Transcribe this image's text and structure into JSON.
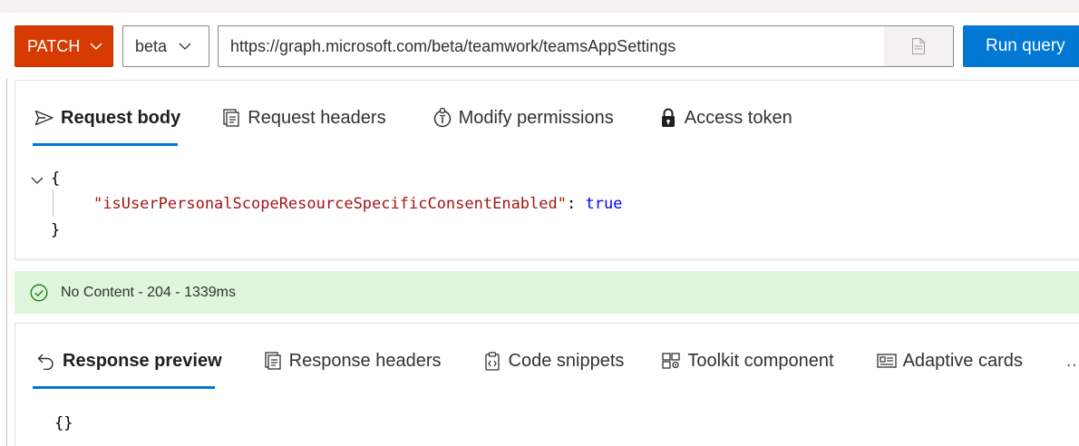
{
  "query": {
    "method": "PATCH",
    "version": "beta",
    "url": "https://graph.microsoft.com/beta/teamwork/teamsAppSettings",
    "run_label": "Run query"
  },
  "request_tabs": [
    {
      "label": "Request body",
      "icon": "send-icon",
      "active": true
    },
    {
      "label": "Request headers",
      "icon": "headers-icon",
      "active": false
    },
    {
      "label": "Modify permissions",
      "icon": "permissions-icon",
      "active": false
    },
    {
      "label": "Access token",
      "icon": "lock-icon",
      "active": false
    }
  ],
  "request_body": {
    "open_brace": "{",
    "key": "\"isUserPersonalScopeResourceSpecificConsentEnabled\"",
    "colon": ": ",
    "value": "true",
    "close_brace": "}"
  },
  "status": {
    "text": "No Content - 204 - 1339ms",
    "color": "#dff6dd"
  },
  "response_tabs": [
    {
      "label": "Response preview",
      "icon": "undo-arrow-icon",
      "active": true
    },
    {
      "label": "Response headers",
      "icon": "headers-icon",
      "active": false
    },
    {
      "label": "Code snippets",
      "icon": "code-snippet-icon",
      "active": false
    },
    {
      "label": "Toolkit component",
      "icon": "toolkit-icon",
      "active": false
    },
    {
      "label": "Adaptive cards",
      "icon": "card-icon",
      "active": false
    }
  ],
  "response_body": "{}",
  "more_label": "…",
  "colors": {
    "method": "#d83b01",
    "run": "#0078d4",
    "accent": "#0078d4"
  }
}
